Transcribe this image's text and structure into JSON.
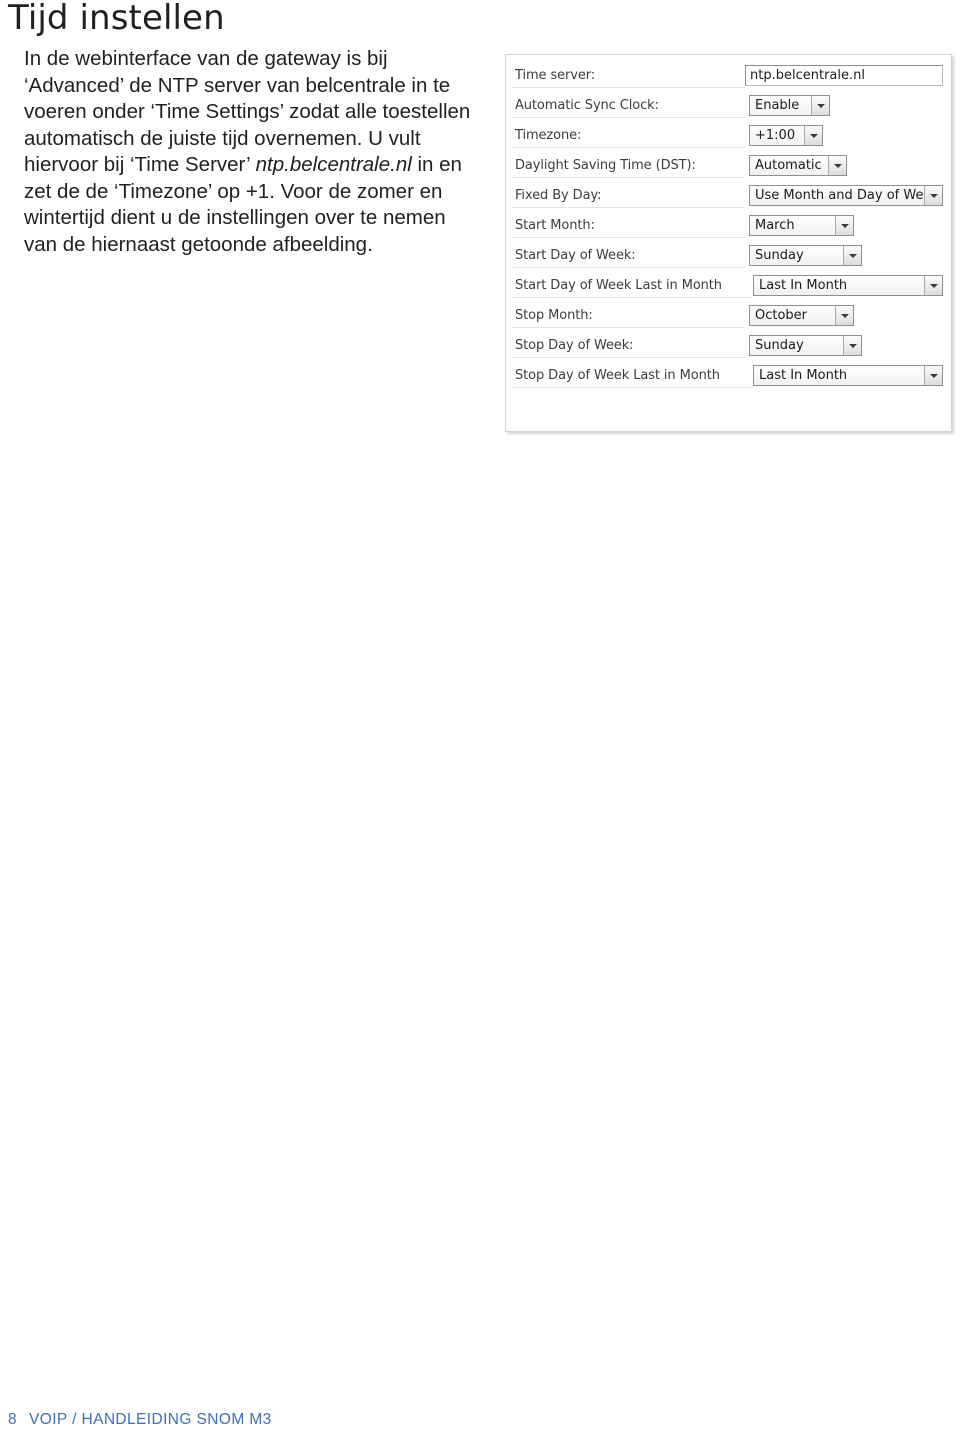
{
  "page": {
    "title": "Tijd instellen",
    "body_paragraph": "In de webinterface van de gateway is bij ‘Advanced’ de NTP server van belcentrale in te voeren onder ‘Time Settings’ zodat alle toestellen automatisch de juiste tijd overnemen. U vult hiervoor bij ‘Time Server’ ",
    "body_italic": "ntp.belcentrale.nl",
    "body_paragraph_2": " in en zet de de ‘Timezone’ op +1. Voor de zomer en wintertijd dient u de instellingen over te nemen van de hiernaast getoonde afbeelding."
  },
  "screenshot": {
    "rows": [
      {
        "label": "Time server:",
        "value": "ntp.belcentrale.nl",
        "control": "text"
      },
      {
        "label": "Automatic Sync Clock:",
        "value": "Enable",
        "control": "select"
      },
      {
        "label": "Timezone:",
        "value": "+1:00",
        "control": "select"
      },
      {
        "label": "Daylight Saving Time (DST):",
        "value": "Automatic",
        "control": "select"
      },
      {
        "label": "Fixed By Day:",
        "value": "Use Month and Day of Week",
        "control": "select"
      },
      {
        "label": "Start Month:",
        "value": "March",
        "control": "select"
      },
      {
        "label": "Start Day of Week:",
        "value": "Sunday",
        "control": "select"
      },
      {
        "label": "Start Day of Week Last in Month",
        "value": "Last In Month",
        "control": "select"
      },
      {
        "label": "Stop Month:",
        "value": "October",
        "control": "select"
      },
      {
        "label": "Stop Day of Week:",
        "value": "Sunday",
        "control": "select"
      },
      {
        "label": "Stop Day of Week Last in Month",
        "value": "Last In Month",
        "control": "select"
      }
    ]
  },
  "footer": {
    "page_number": "8",
    "text": "VOIP / HANDLEIDING SNOM M3"
  },
  "colors": {
    "text": "#231f20",
    "footer": "#3f6fb5",
    "panel_border": "#d3d3d3"
  }
}
